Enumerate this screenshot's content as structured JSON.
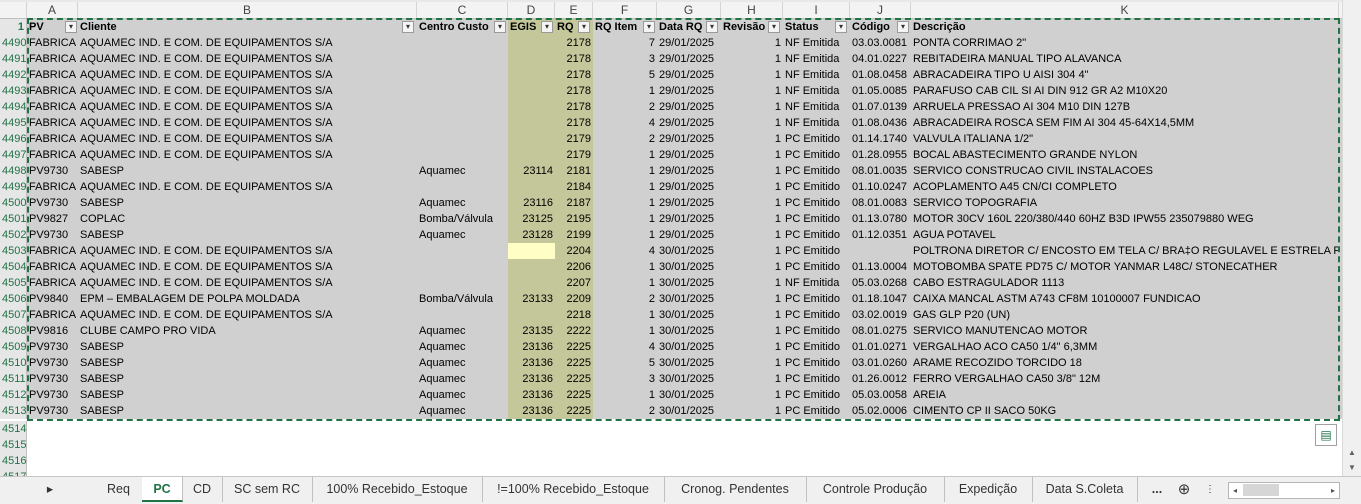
{
  "columns": [
    "A",
    "B",
    "C",
    "D",
    "E",
    "F",
    "G",
    "H",
    "I",
    "J",
    "K"
  ],
  "header_row_number": "1",
  "headers": {
    "pv": "PV",
    "cliente": "Cliente",
    "centro": "Centro Custo",
    "egis": "EGIS",
    "rq": "RQ",
    "rqitem": "RQ Item",
    "data": "Data RQ",
    "rev": "Revisão",
    "status": "Status",
    "codigo": "Código",
    "desc": "Descrição"
  },
  "rows": [
    {
      "n": "4490",
      "pv": "FABRICA",
      "cliente": "AQUAMEC IND. E COM. DE EQUIPAMENTOS S/A",
      "centro": "",
      "egis": "",
      "rq": "2178",
      "item": "7",
      "data": "29/01/2025",
      "rev": "1",
      "status": "NF Emitida",
      "codigo": "03.03.0081",
      "desc": "PONTA CORRIMAO 2\""
    },
    {
      "n": "4491",
      "pv": "FABRICA",
      "cliente": "AQUAMEC IND. E COM. DE EQUIPAMENTOS S/A",
      "centro": "",
      "egis": "",
      "rq": "2178",
      "item": "3",
      "data": "29/01/2025",
      "rev": "1",
      "status": "NF Emitida",
      "codigo": "04.01.0227",
      "desc": "REBITADEIRA MANUAL TIPO ALAVANCA"
    },
    {
      "n": "4492",
      "pv": "FABRICA",
      "cliente": "AQUAMEC IND. E COM. DE EQUIPAMENTOS S/A",
      "centro": "",
      "egis": "",
      "rq": "2178",
      "item": "5",
      "data": "29/01/2025",
      "rev": "1",
      "status": "NF Emitida",
      "codigo": "01.08.0458",
      "desc": "ABRACADEIRA TIPO U AISI 304 4\""
    },
    {
      "n": "4493",
      "pv": "FABRICA",
      "cliente": "AQUAMEC IND. E COM. DE EQUIPAMENTOS S/A",
      "centro": "",
      "egis": "",
      "rq": "2178",
      "item": "1",
      "data": "29/01/2025",
      "rev": "1",
      "status": "NF Emitida",
      "codigo": "01.05.0085",
      "desc": "PARAFUSO CAB CIL SI AI DIN 912 GR A2 M10X20"
    },
    {
      "n": "4494",
      "pv": "FABRICA",
      "cliente": "AQUAMEC IND. E COM. DE EQUIPAMENTOS S/A",
      "centro": "",
      "egis": "",
      "rq": "2178",
      "item": "2",
      "data": "29/01/2025",
      "rev": "1",
      "status": "NF Emitida",
      "codigo": "01.07.0139",
      "desc": "ARRUELA PRESSAO AI 304 M10 DIN 127B"
    },
    {
      "n": "4495",
      "pv": "FABRICA",
      "cliente": "AQUAMEC IND. E COM. DE EQUIPAMENTOS S/A",
      "centro": "",
      "egis": "",
      "rq": "2178",
      "item": "4",
      "data": "29/01/2025",
      "rev": "1",
      "status": "NF Emitida",
      "codigo": "01.08.0436",
      "desc": "ABRACADEIRA ROSCA SEM FIM AI 304 45-64X14,5MM"
    },
    {
      "n": "4496",
      "pv": "FABRICA",
      "cliente": "AQUAMEC IND. E COM. DE EQUIPAMENTOS S/A",
      "centro": "",
      "egis": "",
      "rq": "2179",
      "item": "2",
      "data": "29/01/2025",
      "rev": "1",
      "status": "PC Emitido",
      "codigo": "01.14.1740",
      "desc": "VALVULA ITALIANA 1/2\""
    },
    {
      "n": "4497",
      "pv": "FABRICA",
      "cliente": "AQUAMEC IND. E COM. DE EQUIPAMENTOS S/A",
      "centro": "",
      "egis": "",
      "rq": "2179",
      "item": "1",
      "data": "29/01/2025",
      "rev": "1",
      "status": "PC Emitido",
      "codigo": "01.28.0955",
      "desc": "BOCAL ABASTECIMENTO GRANDE NYLON"
    },
    {
      "n": "4498",
      "pv": "PV9730",
      "cliente": "SABESP",
      "centro": "Aquamec",
      "egis": "23114",
      "rq": "2181",
      "item": "1",
      "data": "29/01/2025",
      "rev": "1",
      "status": "PC Emitido",
      "codigo": "08.01.0035",
      "desc": "SERVICO CONSTRUCAO CIVIL INSTALACOES"
    },
    {
      "n": "4499",
      "pv": "FABRICA",
      "cliente": "AQUAMEC IND. E COM. DE EQUIPAMENTOS S/A",
      "centro": "",
      "egis": "",
      "rq": "2184",
      "item": "1",
      "data": "29/01/2025",
      "rev": "1",
      "status": "PC Emitido",
      "codigo": "01.10.0247",
      "desc": "ACOPLAMENTO A45 CN/CI COMPLETO"
    },
    {
      "n": "4500",
      "pv": "PV9730",
      "cliente": "SABESP",
      "centro": "Aquamec",
      "egis": "23116",
      "rq": "2187",
      "item": "1",
      "data": "29/01/2025",
      "rev": "1",
      "status": "PC Emitido",
      "codigo": "08.01.0083",
      "desc": "SERVICO TOPOGRAFIA"
    },
    {
      "n": "4501",
      "pv": "PV9827",
      "cliente": "COPLAC",
      "centro": "Bomba/Válvula",
      "egis": "23125",
      "rq": "2195",
      "item": "1",
      "data": "29/01/2025",
      "rev": "1",
      "status": "PC Emitido",
      "codigo": "01.13.0780",
      "desc": "MOTOR 30CV 160L 220/380/440 60HZ B3D IPW55 235079880 WEG"
    },
    {
      "n": "4502",
      "pv": "PV9730",
      "cliente": "SABESP",
      "centro": "Aquamec",
      "egis": "23128",
      "rq": "2199",
      "item": "1",
      "data": "29/01/2025",
      "rev": "1",
      "status": "PC Emitido",
      "codigo": "01.12.0351",
      "desc": "AGUA POTAVEL"
    },
    {
      "n": "4503",
      "pv": "FABRICA",
      "cliente": "AQUAMEC IND. E COM. DE EQUIPAMENTOS S/A",
      "centro": "",
      "egis": "",
      "rq": "2204",
      "item": "4",
      "data": "30/01/2025",
      "rev": "1",
      "status": "PC Emitido",
      "codigo": "",
      "desc": "POLTRONA DIRETOR C/ ENCOSTO EM TELA C/  BRA‡O REGULAVEL E ESTRELA PIRAMI",
      "egis_yellow": true
    },
    {
      "n": "4504",
      "pv": "FABRICA",
      "cliente": "AQUAMEC IND. E COM. DE EQUIPAMENTOS S/A",
      "centro": "",
      "egis": "",
      "rq": "2206",
      "item": "1",
      "data": "30/01/2025",
      "rev": "1",
      "status": "PC Emitido",
      "codigo": "01.13.0004",
      "desc": "MOTOBOMBA SPATE PD75 C/ MOTOR YANMAR L48C/ STONECATHER"
    },
    {
      "n": "4505",
      "pv": "FABRICA",
      "cliente": "AQUAMEC IND. E COM. DE EQUIPAMENTOS S/A",
      "centro": "",
      "egis": "",
      "rq": "2207",
      "item": "1",
      "data": "30/01/2025",
      "rev": "1",
      "status": "NF Emitida",
      "codigo": "05.03.0268",
      "desc": "CABO ESTRAGULADOR 1113"
    },
    {
      "n": "4506",
      "pv": "PV9840",
      "cliente": "EPM – EMBALAGEM DE POLPA MOLDADA",
      "centro": "Bomba/Válvula",
      "egis": "23133",
      "rq": "2209",
      "item": "2",
      "data": "30/01/2025",
      "rev": "1",
      "status": "PC Emitido",
      "codigo": "01.18.1047",
      "desc": "CAIXA MANCAL ASTM A743 CF8M 10100007 FUNDICAO"
    },
    {
      "n": "4507",
      "pv": "FABRICA",
      "cliente": "AQUAMEC IND. E COM. DE EQUIPAMENTOS S/A",
      "centro": "",
      "egis": "",
      "rq": "2218",
      "item": "1",
      "data": "30/01/2025",
      "rev": "1",
      "status": "PC Emitido",
      "codigo": "03.02.0019",
      "desc": "GAS GLP P20 (UN)"
    },
    {
      "n": "4508",
      "pv": "PV9816",
      "cliente": "CLUBE CAMPO PRO VIDA",
      "centro": "Aquamec",
      "egis": "23135",
      "rq": "2222",
      "item": "1",
      "data": "30/01/2025",
      "rev": "1",
      "status": "PC Emitido",
      "codigo": "08.01.0275",
      "desc": "SERVICO MANUTENCAO MOTOR"
    },
    {
      "n": "4509",
      "pv": "PV9730",
      "cliente": "SABESP",
      "centro": "Aquamec",
      "egis": "23136",
      "rq": "2225",
      "item": "4",
      "data": "30/01/2025",
      "rev": "1",
      "status": "PC Emitido",
      "codigo": "01.01.0271",
      "desc": "VERGALHAO ACO CA50 1/4\" 6,3MM"
    },
    {
      "n": "4510",
      "pv": "PV9730",
      "cliente": "SABESP",
      "centro": "Aquamec",
      "egis": "23136",
      "rq": "2225",
      "item": "5",
      "data": "30/01/2025",
      "rev": "1",
      "status": "PC Emitido",
      "codigo": "03.01.0260",
      "desc": "ARAME RECOZIDO TORCIDO 18"
    },
    {
      "n": "4511",
      "pv": "PV9730",
      "cliente": "SABESP",
      "centro": "Aquamec",
      "egis": "23136",
      "rq": "2225",
      "item": "3",
      "data": "30/01/2025",
      "rev": "1",
      "status": "PC Emitido",
      "codigo": "01.26.0012",
      "desc": "FERRO VERGALHAO CA50 3/8\" 12M"
    },
    {
      "n": "4512",
      "pv": "PV9730",
      "cliente": "SABESP",
      "centro": "Aquamec",
      "egis": "23136",
      "rq": "2225",
      "item": "1",
      "data": "30/01/2025",
      "rev": "1",
      "status": "PC Emitido",
      "codigo": "05.03.0058",
      "desc": "AREIA"
    },
    {
      "n": "4513",
      "pv": "PV9730",
      "cliente": "SABESP",
      "centro": "Aquamec",
      "egis": "23136",
      "rq": "2225",
      "item": "2",
      "data": "30/01/2025",
      "rev": "1",
      "status": "PC Emitido",
      "codigo": "05.02.0006",
      "desc": "CIMENTO CP II SACO 50KG"
    }
  ],
  "empty_rows": [
    "4514",
    "4515",
    "4516",
    "4517"
  ],
  "tabs": [
    "Req",
    "PC",
    "CD",
    "SC sem RC",
    "100% Recebido_Estoque",
    "!=100% Recebido_Estoque",
    "Cronog. Pendentes",
    "Controle Produção",
    "Expedição",
    "Data S.Coleta"
  ],
  "active_tab": "PC",
  "tabs_more": "...",
  "tabs_add": "⊕"
}
